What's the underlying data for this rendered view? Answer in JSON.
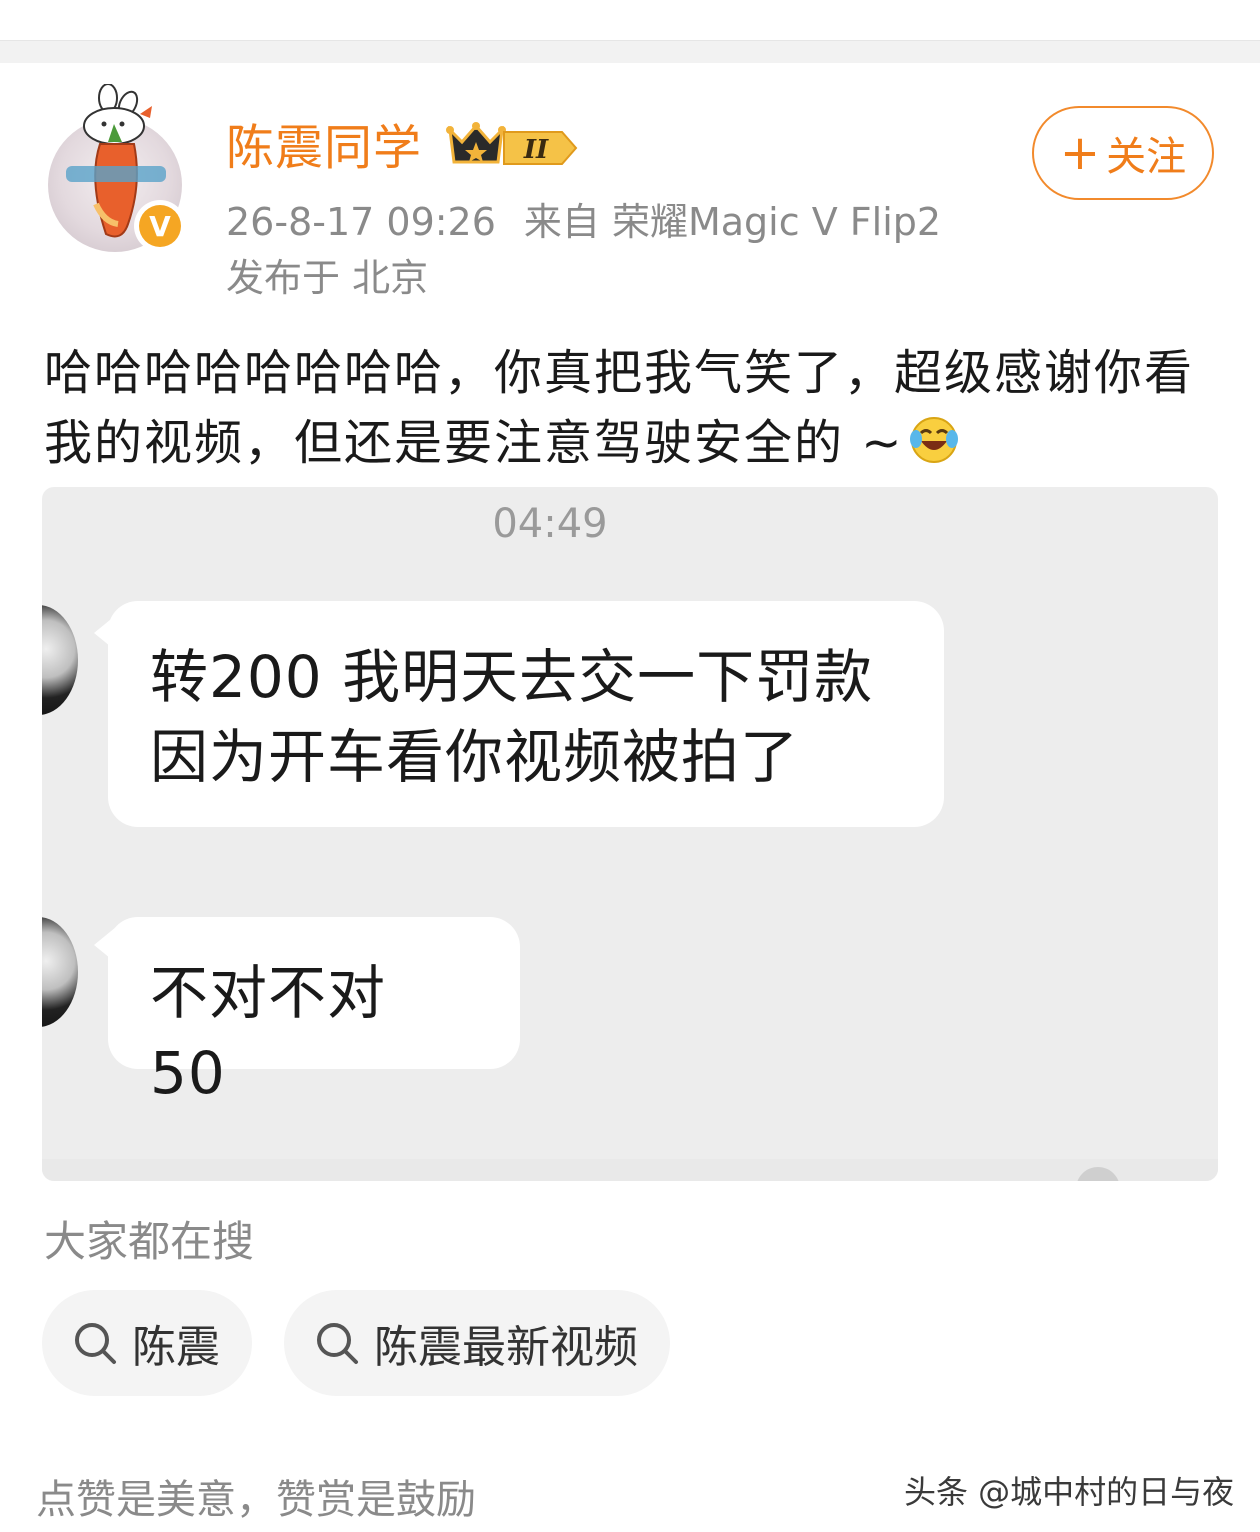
{
  "colors": {
    "brand": "#f07d1a",
    "meta": "#8a8a8a",
    "badge": "#f5a623"
  },
  "user": {
    "name": "陈震同学",
    "level": "II",
    "verified_letter": "V"
  },
  "follow": {
    "plus": "+",
    "label": "关注"
  },
  "meta": {
    "time": "26-8-17 09:26",
    "source": "来自 荣耀Magic V Flip2",
    "location": "发布于 北京"
  },
  "post": {
    "text": "哈哈哈哈哈哈哈哈，你真把我气笑了，超级感谢你看我的视频，但还是要注意驾驶安全的 ~",
    "emoji": "laugh-cry-icon"
  },
  "screenshot": {
    "time": "04:49",
    "messages": [
      {
        "line1": "转200 我明天去交一下罚款",
        "line2": "因为开车看你视频被拍了"
      },
      {
        "line1": "不对不对 50"
      }
    ]
  },
  "search": {
    "title": "大家都在搜",
    "chips": [
      "陈震",
      "陈震最新视频"
    ]
  },
  "footer": {
    "reward_text": "点赞是美意，赞赏是鼓励",
    "watermark": "头条 @城中村的日与夜"
  }
}
